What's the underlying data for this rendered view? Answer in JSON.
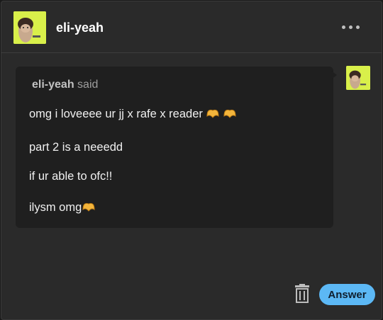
{
  "header": {
    "blog_name": "eli-yeah",
    "avatar_icon": "avatar-icon",
    "more_icon": "ellipsis-icon"
  },
  "ask": {
    "asker_name": "eli-yeah",
    "said_label": "said",
    "lines": [
      "omg i loveeee ur jj x rafe x reader",
      "part 2 is a neeedd",
      "if ur able to ofc!!",
      "ilysm omg"
    ],
    "emoji_name": "heart-hands-emoji"
  },
  "footer": {
    "answer_label": "Answer",
    "delete_icon": "trash-icon"
  },
  "colors": {
    "background": "#2a2a2a",
    "bubble": "#1f1f1f",
    "accent": "#5cb8f5",
    "avatar": "#d9f04a"
  }
}
